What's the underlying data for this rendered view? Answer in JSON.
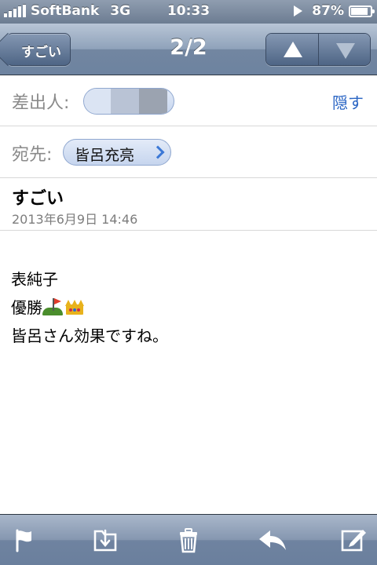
{
  "status_bar": {
    "carrier": "SoftBank",
    "network": "3G",
    "time": "10:33",
    "battery": "87%",
    "battery_level": 0.87
  },
  "nav": {
    "back_label": "すごい",
    "title": "2/2"
  },
  "header": {
    "from_label": "差出人:",
    "hide_label": "隠す",
    "to_label": "宛先:",
    "to_name": "皆呂充亮"
  },
  "message": {
    "subject": "すごい",
    "date": "2013年6月9日 14:46",
    "line1": "表純子",
    "line2": "優勝",
    "line3": "皆呂さん効果ですね。"
  },
  "colors": {
    "link": "#2a65c4",
    "chip_arrow": "#3b78d6"
  }
}
